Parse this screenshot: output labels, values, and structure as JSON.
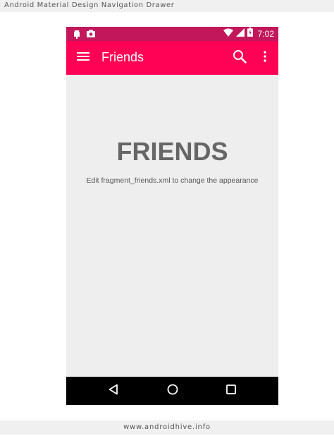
{
  "captions": {
    "top": "Android Material Design Navigation Drawer",
    "bottom": "www.androidhive.info"
  },
  "status_bar": {
    "time": "7:02",
    "left_icons": [
      "android-debug-icon",
      "photo-notification-icon"
    ],
    "right_icons": [
      "wifi-icon",
      "cell-signal-icon",
      "battery-charging-icon"
    ],
    "color": "#c2185b"
  },
  "app_bar": {
    "title": "Friends",
    "color": "#ff0155",
    "nav_icon": "hamburger-menu-icon",
    "action_icons": [
      "search-icon",
      "more-vert-icon"
    ]
  },
  "content": {
    "heading": "FRIENDS",
    "subtext": "Edit fragment_friends.xml to change the appearance",
    "background": "#eeeeee"
  },
  "nav_bar": {
    "buttons": [
      "back-icon",
      "home-icon",
      "recents-icon"
    ]
  }
}
